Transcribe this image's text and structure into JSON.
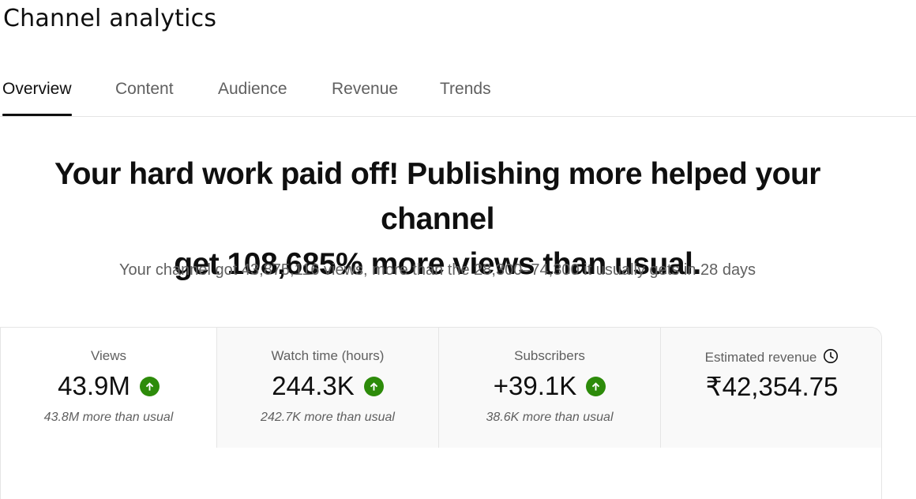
{
  "header": {
    "title": "Channel analytics"
  },
  "tabs": [
    {
      "label": "Overview",
      "active": true
    },
    {
      "label": "Content",
      "active": false
    },
    {
      "label": "Audience",
      "active": false
    },
    {
      "label": "Revenue",
      "active": false
    },
    {
      "label": "Trends",
      "active": false
    }
  ],
  "insight": {
    "headline_line1": "Your hard work paid off! Publishing more helped your channel",
    "headline_line2": "get 108,685% more views than usual.",
    "subline": "Your channel got 43,875,116 views, more than the 28,300–74,300 it usually gets in 28 days"
  },
  "metrics": [
    {
      "label": "Views",
      "value": "43.9M",
      "note": "43.8M more than usual",
      "trend": "up-icon"
    },
    {
      "label": "Watch time (hours)",
      "value": "244.3K",
      "note": "242.7K more than usual",
      "trend": "up-icon"
    },
    {
      "label": "Subscribers",
      "value": "+39.1K",
      "note": "38.6K more than usual",
      "trend": "up-icon"
    },
    {
      "label": "Estimated revenue",
      "value": "₹42,354.75",
      "note": "",
      "label_icon": "clock-icon"
    }
  ],
  "colors": {
    "trend_up": "#2d8b0a",
    "text_primary": "#0f0f0f",
    "text_secondary": "#606060"
  }
}
